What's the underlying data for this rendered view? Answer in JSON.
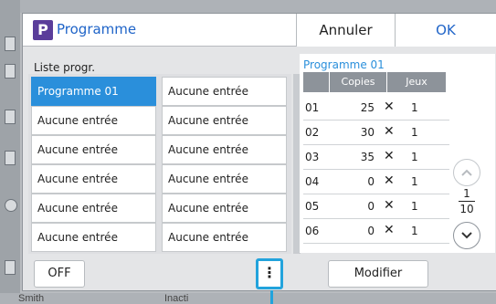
{
  "dialog": {
    "title": "Programme",
    "app_badge": "P",
    "cancel_label": "Annuler",
    "ok_label": "OK"
  },
  "list": {
    "label": "Liste progr.",
    "items": [
      {
        "label": "Programme 01",
        "selected": true
      },
      {
        "label": "Aucune entrée"
      },
      {
        "label": "Aucune entrée"
      },
      {
        "label": "Aucune entrée"
      },
      {
        "label": "Aucune entrée"
      },
      {
        "label": "Aucune entrée"
      },
      {
        "label": "Aucune entrée"
      },
      {
        "label": "Aucune entrée"
      },
      {
        "label": "Aucune entrée"
      },
      {
        "label": "Aucune entrée"
      },
      {
        "label": "Aucune entrée"
      },
      {
        "label": "Aucune entrée"
      }
    ]
  },
  "detail": {
    "title": "Programme 01",
    "col_copies": "Copies",
    "col_sets": "Jeux",
    "times_symbol": "✕",
    "rows": [
      {
        "num": "01",
        "copies": "25",
        "sets": "1"
      },
      {
        "num": "02",
        "copies": "30",
        "sets": "1"
      },
      {
        "num": "03",
        "copies": "35",
        "sets": "1"
      },
      {
        "num": "04",
        "copies": "0",
        "sets": "1"
      },
      {
        "num": "05",
        "copies": "0",
        "sets": "1"
      },
      {
        "num": "06",
        "copies": "0",
        "sets": "1"
      }
    ]
  },
  "pager": {
    "current": "1",
    "total": "10",
    "up_icon": "chevron-up-icon",
    "down_icon": "chevron-down-icon"
  },
  "footer": {
    "off_label": "OFF",
    "more_label": "⋮",
    "modify_label": "Modifier"
  },
  "background": {
    "user": "Smith",
    "status": "Inacti"
  },
  "colors": {
    "accent": "#2a8fdb",
    "title_blue": "#1f64c8",
    "badge": "#5a3d9a",
    "highlight": "#22a3dc"
  }
}
